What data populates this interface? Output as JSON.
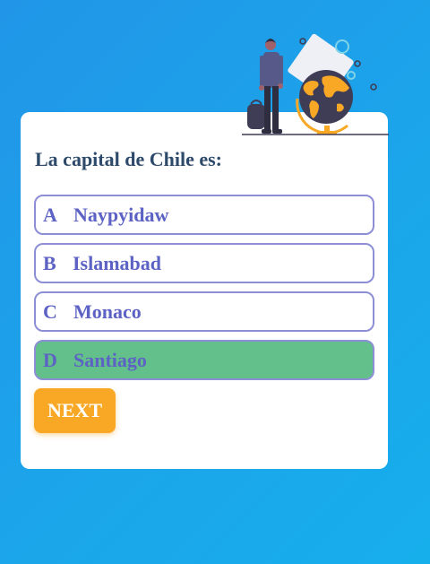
{
  "quiz": {
    "question": "La capital de Chile es:",
    "options": [
      {
        "letter": "A",
        "text": "Naypyidaw",
        "state": "default"
      },
      {
        "letter": "B",
        "text": "Islamabad",
        "state": "default"
      },
      {
        "letter": "C",
        "text": "Monaco",
        "state": "default"
      },
      {
        "letter": "D",
        "text": "Santiago",
        "state": "correct"
      }
    ],
    "next_label": "NEXT"
  },
  "illustration": {
    "icon": "traveler-globe-illustration"
  },
  "colors": {
    "background_start": "#2196e8",
    "background_end": "#17aeec",
    "card": "#ffffff",
    "question_text": "#2e4a6b",
    "option_text": "#5d63c4",
    "option_border": "#8d8fd6",
    "correct_fill": "#63c08a",
    "next_button": "#f9a825"
  }
}
